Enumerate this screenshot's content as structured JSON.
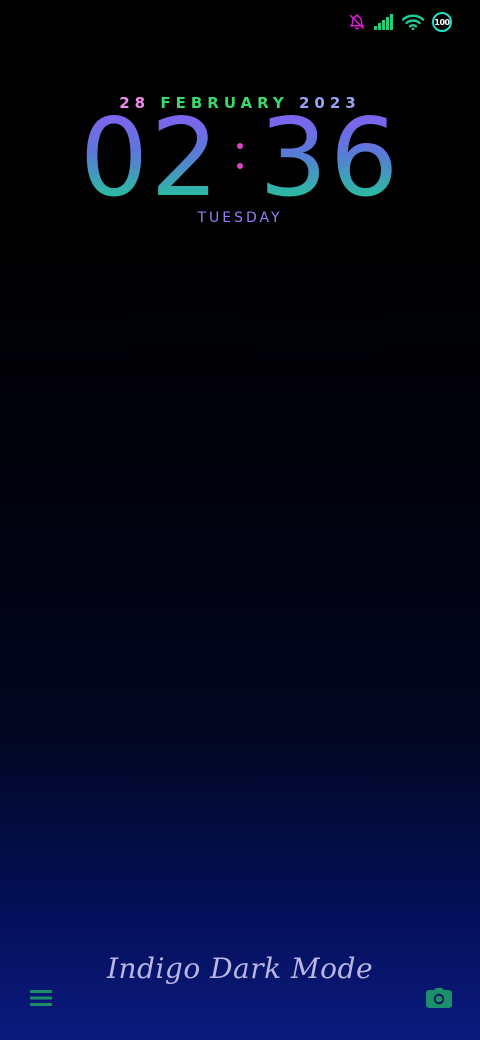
{
  "status_bar": {
    "battery_level": "100",
    "icons": [
      "alarm-off-icon",
      "cellular-signal-icon",
      "wifi-icon",
      "battery-icon"
    ],
    "colors": {
      "alarm": "#d81fd0",
      "signal": "#1fcf7a",
      "wifi": "#1fcf9a",
      "battery": "#22e0c8"
    }
  },
  "lockscreen": {
    "date": {
      "day": "28",
      "month": "FEBRUARY",
      "year": "2023"
    },
    "time": {
      "hours": "02",
      "minutes": "36"
    },
    "weekday": "TUESDAY",
    "signature": "Indigo Dark Mode"
  },
  "shortcuts": {
    "left_icon": "menu-icon",
    "right_icon": "camera-icon",
    "color": "#1a8f6a"
  }
}
